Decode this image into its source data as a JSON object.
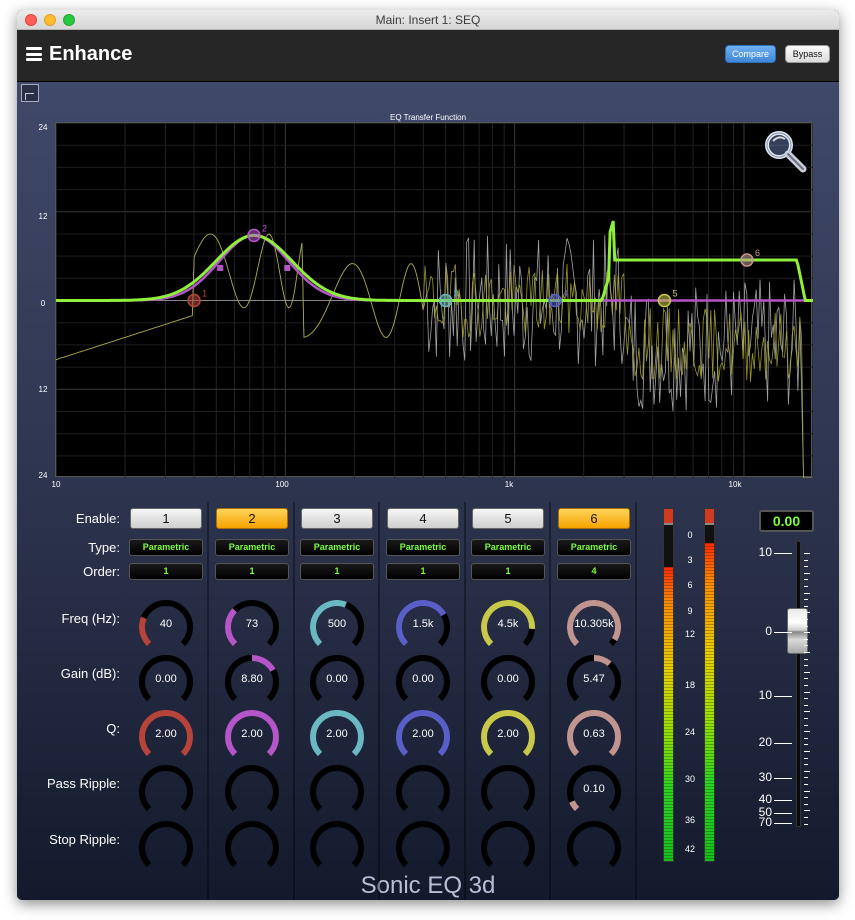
{
  "window": {
    "title": "Main: Insert 1: SEQ"
  },
  "header": {
    "preset_name": "Enhance",
    "compare_label": "Compare",
    "bypass_label": "Bypass"
  },
  "graph": {
    "title": "EQ Transfer Function",
    "y_labels": [
      "24",
      "12",
      "0",
      "12",
      "24"
    ],
    "x_labels": [
      "10",
      "100",
      "1k",
      "10k"
    ],
    "band_markers": [
      "1",
      "2",
      "3",
      "4",
      "5",
      "6"
    ]
  },
  "rows": {
    "enable": "Enable:",
    "type": "Type:",
    "order": "Order:",
    "freq": "Freq (Hz):",
    "gain": "Gain (dB):",
    "q": "Q:",
    "pass_ripple": "Pass Ripple:",
    "stop_ripple": "Stop Ripple:"
  },
  "bands": [
    {
      "label": "1",
      "enabled": false,
      "type": "Parametric",
      "order": "1",
      "freq": "40",
      "gain": "0.00",
      "q": "2.00",
      "pass_ripple": "",
      "color": "#b5453a",
      "freq_level": 0.25,
      "gain_level": 0.0,
      "q_level": 1.0,
      "pr_level": 0.0
    },
    {
      "label": "2",
      "enabled": true,
      "type": "Parametric",
      "order": "1",
      "freq": "73",
      "gain": "8.80",
      "q": "2.00",
      "pass_ripple": "",
      "color": "#b455c8",
      "freq_level": 0.33,
      "gain_level": 0.18,
      "q_level": 1.0,
      "pr_level": 0.0
    },
    {
      "label": "3",
      "enabled": false,
      "type": "Parametric",
      "order": "1",
      "freq": "500",
      "gain": "0.00",
      "q": "2.00",
      "pass_ripple": "",
      "color": "#6ab8c2",
      "freq_level": 0.58,
      "gain_level": 0.0,
      "q_level": 1.0,
      "pr_level": 0.0
    },
    {
      "label": "4",
      "enabled": false,
      "type": "Parametric",
      "order": "1",
      "freq": "1.5k",
      "gain": "0.00",
      "q": "2.00",
      "pass_ripple": "",
      "color": "#5a5fc8",
      "freq_level": 0.72,
      "gain_level": 0.0,
      "q_level": 1.0,
      "pr_level": 0.0
    },
    {
      "label": "5",
      "enabled": false,
      "type": "Parametric",
      "order": "1",
      "freq": "4.5k",
      "gain": "0.00",
      "q": "2.00",
      "pass_ripple": "",
      "color": "#c8c84a",
      "freq_level": 0.85,
      "gain_level": 0.0,
      "q_level": 1.0,
      "pr_level": 0.0
    },
    {
      "label": "6",
      "enabled": true,
      "type": "Parametric",
      "order": "4",
      "freq": "10.305k",
      "gain": "5.47",
      "q": "0.63",
      "pass_ripple": "0.10",
      "color": "#c09590",
      "freq_level": 0.95,
      "gain_level": 0.12,
      "q_level": 1.0,
      "pr_level": 0.08
    }
  ],
  "meters": {
    "scale": [
      "0",
      "3",
      "6",
      "9",
      "12",
      "18",
      "24",
      "30",
      "36",
      "42"
    ],
    "left_level": 0.96,
    "right_level": 0.94
  },
  "fader": {
    "value": "0.00",
    "scale": [
      "10",
      "0",
      "10",
      "20",
      "30",
      "40",
      "50",
      "70"
    ]
  },
  "brand": "Sonic EQ 3d"
}
